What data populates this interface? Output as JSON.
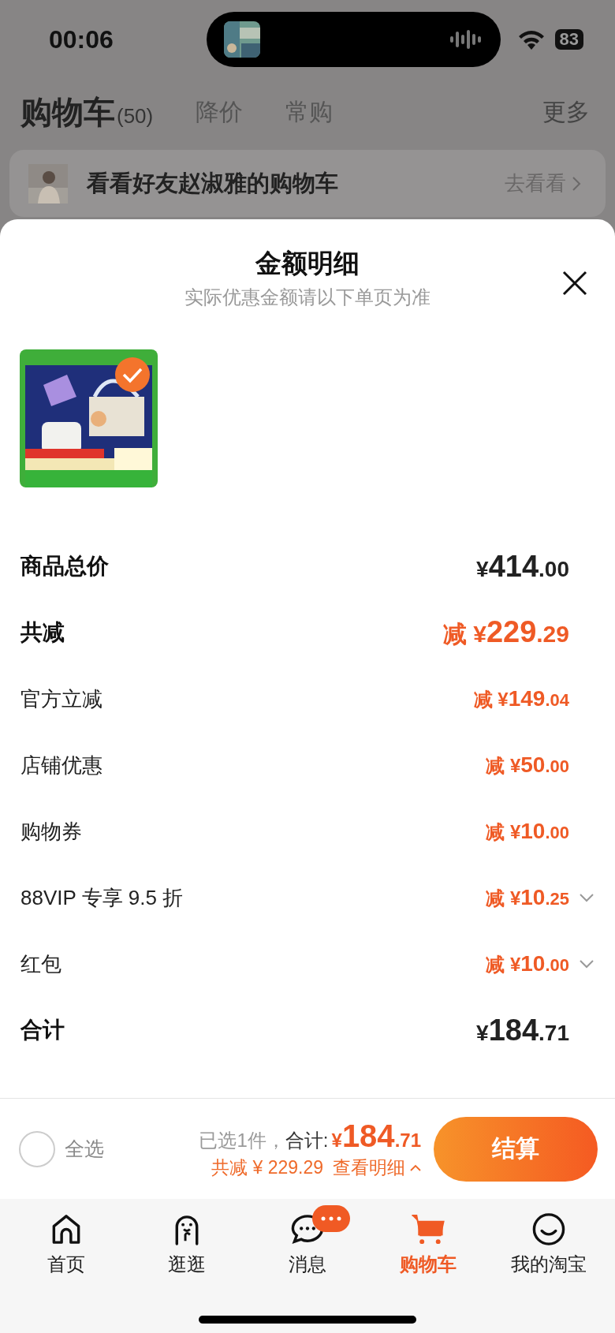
{
  "status_bar": {
    "time": "00:06",
    "battery": "83"
  },
  "header": {
    "title": "购物车",
    "count": "(50)",
    "tabs": [
      {
        "label": "降价"
      },
      {
        "label": "常购"
      }
    ],
    "more": "更多"
  },
  "friend_bar": {
    "text": "看看好友赵淑雅的购物车",
    "action": "去看看"
  },
  "sheet": {
    "title": "金额明细",
    "subtitle": "实际优惠金额请以下单页为准",
    "product": {
      "kind": "picture",
      "selected": true
    },
    "rows": [
      {
        "kind": "subtotal",
        "label": "商品总价",
        "value": "¥414.00",
        "expandable": false
      },
      {
        "kind": "discount_total",
        "label": "共减",
        "value": "减 ¥229.29",
        "expandable": false
      },
      {
        "kind": "discount",
        "label": "官方立减",
        "value": "减 ¥149.04",
        "expandable": false
      },
      {
        "kind": "discount",
        "label": "店铺优惠",
        "value": "减 ¥50.00",
        "expandable": false
      },
      {
        "kind": "discount",
        "label": "购物券",
        "value": "减 ¥10.00",
        "expandable": false
      },
      {
        "kind": "discount",
        "label": "88VIP 专享 9.5 折",
        "value": "减 ¥10.25",
        "expandable": true
      },
      {
        "kind": "discount",
        "label": "红包",
        "value": "减 ¥10.00",
        "expandable": true
      },
      {
        "kind": "total",
        "label": "合计",
        "value": "¥184.71",
        "expandable": false
      }
    ]
  },
  "checkout": {
    "select_all": {
      "label": "全选",
      "checked": false
    },
    "selected_count": "已选1件，",
    "total_label": "合计:",
    "total": "¥184.71",
    "saved": "共减 ¥ 229.29",
    "details": "查看明细",
    "button": "结算"
  },
  "tab_bar": [
    {
      "label": "首页",
      "kind": "home",
      "selected": false
    },
    {
      "label": "逛逛",
      "kind": "explore",
      "selected": false
    },
    {
      "label": "消息",
      "kind": "chat",
      "selected": false,
      "badge": true
    },
    {
      "label": "购物车",
      "kind": "cart",
      "selected": true
    },
    {
      "label": "我的淘宝",
      "kind": "smile",
      "selected": false
    }
  ]
}
